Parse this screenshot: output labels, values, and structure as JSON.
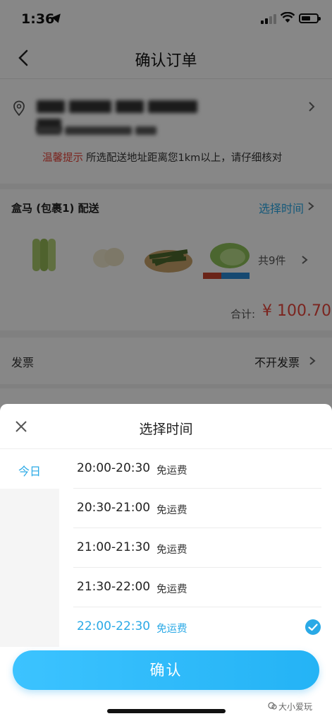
{
  "status_bar": {
    "time": "1:36"
  },
  "nav": {
    "title": "确认订单"
  },
  "address": {
    "tip_label": "温馨提示",
    "tip_text": "所选配送地址距离您1km以上，请仔细核对"
  },
  "order": {
    "store_name": "盒马 (包裹1) 配送",
    "select_time_link": "选择时间",
    "goods_count": "共9件",
    "total_label": "合计:",
    "total_amount": "¥ 100.70"
  },
  "invoice": {
    "label": "发票",
    "value": "不开发票"
  },
  "sheet": {
    "title": "选择时间",
    "days": [
      {
        "label": "今日"
      }
    ],
    "slots": [
      {
        "time": "20:00-20:30",
        "fee": "免运费",
        "selected": false
      },
      {
        "time": "20:30-21:00",
        "fee": "免运费",
        "selected": false
      },
      {
        "time": "21:00-21:30",
        "fee": "免运费",
        "selected": false
      },
      {
        "time": "21:30-22:00",
        "fee": "免运费",
        "selected": false
      },
      {
        "time": "22:00-22:30",
        "fee": "免运费",
        "selected": true
      }
    ],
    "confirm_label": "确认"
  },
  "watermark": "大小爱玩",
  "colors": {
    "accent": "#2aa9e6",
    "price": "#e8463c",
    "button": "#24b3f5"
  }
}
